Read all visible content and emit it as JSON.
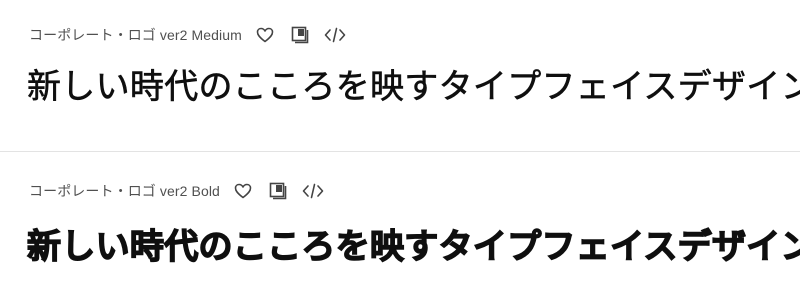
{
  "fonts": [
    {
      "name": "コーポレート・ロゴ ver2 Medium",
      "sample": "新しい時代のこころを映すタイプフェイスデザイン",
      "actions": [
        "heart-icon",
        "add-to-library-icon",
        "embed-code-icon"
      ]
    },
    {
      "name": "コーポレート・ロゴ ver2 Bold",
      "sample": "新しい時代のこころを映すタイプフェイスデザイン",
      "actions": [
        "heart-icon",
        "add-to-library-icon",
        "embed-code-icon"
      ]
    }
  ],
  "colors": {
    "text": "#0f0f0f",
    "meta": "#505050",
    "icon": "#444444",
    "divider": "#e3e3e3"
  }
}
